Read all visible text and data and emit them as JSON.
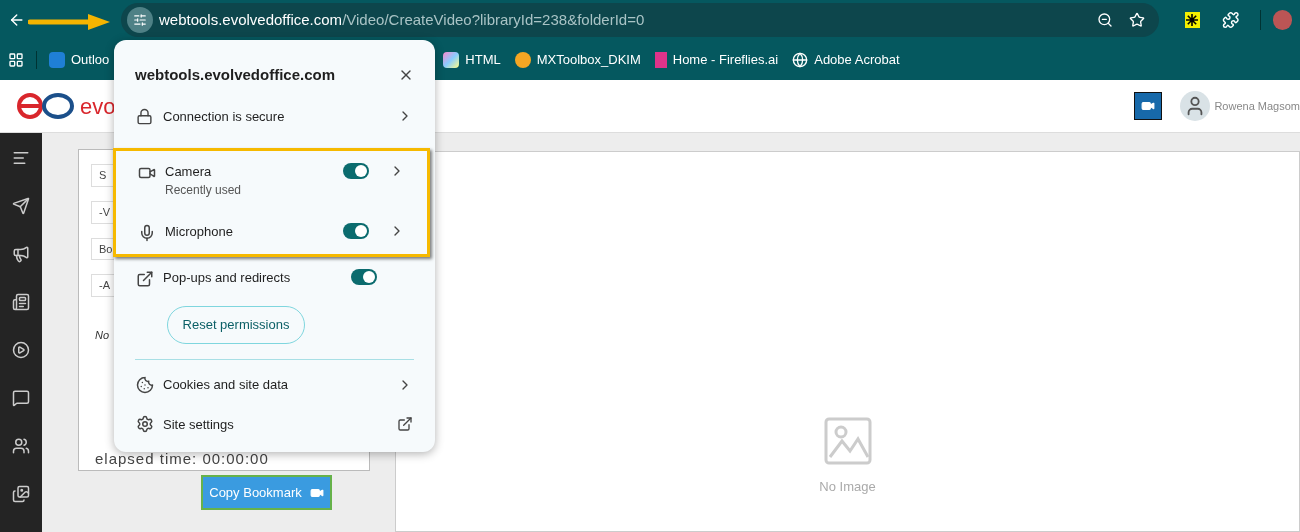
{
  "browser": {
    "url_host": "webtools.evolvedoffice.com",
    "url_path": "/Video/CreateVideo?libraryId=238&folderId=0"
  },
  "bookmarks": [
    {
      "kind": "outlook",
      "label": "Outloo"
    },
    {
      "kind": "html",
      "label": "HTML"
    },
    {
      "kind": "mxtoolbox",
      "label": "MXToolbox_DKIM"
    },
    {
      "kind": "fireflies",
      "label": "Home - Fireflies.ai"
    },
    {
      "kind": "globe",
      "label": "Adobe Acrobat"
    }
  ],
  "app": {
    "logo_text": "evo",
    "user_name": "Rowena Magsom"
  },
  "form": {
    "fields": [
      "S",
      "-V",
      "Bo",
      "-A"
    ],
    "note": "No",
    "elapsed": "elapsed time: 00:00:00",
    "copy_button": "Copy Bookmark"
  },
  "preview": {
    "empty_text": "No Image"
  },
  "popup": {
    "title": "webtools.evolvedoffice.com",
    "connection": "Connection is secure",
    "permissions": [
      {
        "kind": "camera",
        "label": "Camera",
        "sub": "Recently used",
        "on": true,
        "chevron": true,
        "highlighted": true
      },
      {
        "kind": "microphone",
        "label": "Microphone",
        "on": true,
        "chevron": true,
        "highlighted": true
      },
      {
        "kind": "popups",
        "label": "Pop-ups and redirects",
        "on": true,
        "chevron": false,
        "highlighted": false
      }
    ],
    "reset_button": "Reset permissions",
    "links": [
      {
        "kind": "cookies",
        "label": "Cookies and site data"
      },
      {
        "kind": "settings",
        "label": "Site settings"
      }
    ]
  }
}
